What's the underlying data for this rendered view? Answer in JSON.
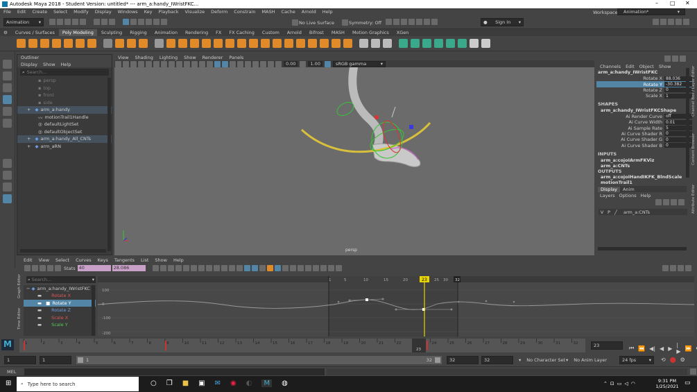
{
  "window": {
    "title": "Autodesk Maya 2018 - Student Version: untitled*   ---   arm_a:handy_IWristFKC...",
    "controls": [
      "–",
      "□",
      "✕"
    ]
  },
  "menu": [
    "File",
    "Edit",
    "Create",
    "Select",
    "Modify",
    "Display",
    "Windows",
    "Key",
    "Playback",
    "Visualize",
    "Deform",
    "Constrain",
    "MASH",
    "Cache",
    "Arnold",
    "Help"
  ],
  "workspace": {
    "label": "Workspace :",
    "value": "Animation*"
  },
  "statusline": {
    "menuset": "Animation",
    "live_surface": "No Live Surface",
    "symmetry": "Symmetry: Off",
    "sign_in": "Sign In"
  },
  "shelf_tabs": [
    "Curves / Surfaces",
    "Poly Modeling",
    "Sculpting",
    "Rigging",
    "Animation",
    "Rendering",
    "FX",
    "FX Caching",
    "Custom",
    "Arnold",
    "Bifrost",
    "MASH",
    "Motion Graphics",
    "XGen"
  ],
  "shelf_tab_active": "Poly Modeling",
  "colors": {
    "selection": "#5285a6",
    "timeline_marker": "#e8d400",
    "curve_yellow": "#d9c03c",
    "viewport": "#6b6b6b",
    "key_red": "#c33"
  },
  "outliner": {
    "title": "Outliner",
    "menu": [
      "Display",
      "Show",
      "Help"
    ],
    "search_placeholder": "Search...",
    "items": [
      {
        "label": "persp",
        "dim": true,
        "icon": "camera-icon"
      },
      {
        "label": "top",
        "dim": true,
        "icon": "camera-icon"
      },
      {
        "label": "front",
        "dim": true,
        "icon": "camera-icon"
      },
      {
        "label": "side",
        "dim": true,
        "icon": "camera-icon"
      },
      {
        "label": "arm_a:handy",
        "dim": false,
        "icon": "group-icon",
        "expander": true,
        "selected": true
      },
      {
        "label": "motionTrail1Handle",
        "dim": false,
        "icon": "motion-trail-icon"
      },
      {
        "label": "defaultLightSet",
        "dim": false,
        "icon": "set-icon"
      },
      {
        "label": "defaultObjectSet",
        "dim": false,
        "icon": "set-icon"
      },
      {
        "label": "arm_a:handy_All_CNTs",
        "dim": false,
        "icon": "group-icon",
        "expander": true,
        "selected": true
      },
      {
        "label": "arm_aRN",
        "dim": false,
        "icon": "reference-icon",
        "expander": true
      }
    ]
  },
  "viewport": {
    "menu": [
      "View",
      "Shading",
      "Lighting",
      "Show",
      "Renderer",
      "Panels"
    ],
    "exposure": "0.00",
    "gamma": "1.00",
    "colorspace": "sRGB gamma",
    "camera_label": "persp"
  },
  "channel_box": {
    "menu": [
      "Channels",
      "Edit",
      "Object",
      "Show"
    ],
    "node": "arm_a:handy_IWristFKC",
    "attributes": [
      {
        "name": "Rotate X",
        "value": "88.036",
        "highlighted": false
      },
      {
        "name": "Rotate Y",
        "value": "-30.382",
        "highlighted": true
      },
      {
        "name": "Rotate Z",
        "value": "0",
        "highlighted": false
      },
      {
        "name": "Scale X",
        "value": "1",
        "highlighted": false
      }
    ],
    "shapes_header": "SHAPES",
    "shape_node": "arm_a:handy_IWristFKCShape",
    "shape_attributes": [
      {
        "name": "Ai Render Curve",
        "value": "off"
      },
      {
        "name": "Ai Curve Width",
        "value": "0.01"
      },
      {
        "name": "Ai Sample Rate",
        "value": "5"
      },
      {
        "name": "Ai Curve Shader R",
        "value": "0"
      },
      {
        "name": "Ai Curve Shader G",
        "value": "0"
      },
      {
        "name": "Ai Curve Shader B",
        "value": "0"
      }
    ],
    "inputs_header": "INPUTS",
    "inputs": [
      "arm_a:cojoIArmFKViz",
      "arm_a:CNTs"
    ],
    "outputs_header": "OUTPUTS",
    "outputs": [
      "arm_a:cojoIHandIKFK_BlndScale",
      "motionTrail1"
    ],
    "layer_tabs": [
      "Display",
      "Anim"
    ],
    "layer_menu": [
      "Layers",
      "Options",
      "Help"
    ],
    "layer": {
      "v": "V",
      "p": "P",
      "name": "arm_a:CNTs"
    },
    "side_tabs": [
      "Channel Box / Layer Editor",
      "Content Browser",
      "Attribute Editor"
    ]
  },
  "graph_editor": {
    "menu": [
      "Edit",
      "View",
      "Select",
      "Curves",
      "Keys",
      "Tangents",
      "List",
      "Show",
      "Help"
    ],
    "stats_label": "Stats",
    "stats_values": [
      "40",
      "28.086"
    ],
    "search_placeholder": "Search...",
    "side_tabs": [
      "Graph Editor",
      "Time Editor"
    ],
    "channels": [
      {
        "label": "arm_a:handy_IWristFKC",
        "color": "#ccc",
        "selected": false
      },
      {
        "label": "Rotate X",
        "color": "#d55",
        "selected": false
      },
      {
        "label": "Rotate Y",
        "color": "#fff",
        "selected": true
      },
      {
        "label": "Rotate Z",
        "color": "#6a9de0",
        "selected": false
      },
      {
        "label": "Scale X",
        "color": "#d55",
        "selected": false
      },
      {
        "label": "Scale Y",
        "color": "#5c5",
        "selected": false
      }
    ],
    "y_labels": [
      "100",
      "0",
      "-100",
      "-200"
    ],
    "frame_labels": [
      "1",
      "5",
      "10",
      "15",
      "20",
      "23",
      "25",
      "30",
      "32"
    ],
    "current_frame": "23"
  },
  "time_slider": {
    "ticks": [
      "1",
      "2",
      "3",
      "4",
      "5",
      "6",
      "7",
      "8",
      "9",
      "10",
      "11",
      "12",
      "13",
      "14",
      "15",
      "16",
      "17",
      "18",
      "19",
      "20",
      "21",
      "22",
      "23",
      "24",
      "25",
      "26",
      "27",
      "28",
      "29",
      "30",
      "31",
      "32"
    ],
    "current_frame": "23",
    "current_frame_field": "23"
  },
  "range_slider": {
    "start": "1",
    "playback_start": "1",
    "bar_start": "1",
    "bar_end": "32",
    "playback_end": "32",
    "end": "32",
    "character_set": "No Character Set",
    "anim_layer": "No Anim Layer",
    "fps": "24 fps"
  },
  "mel": {
    "label": "MEL"
  },
  "taskbar": {
    "search_placeholder": "Type here to search",
    "time": "9:31 PM",
    "date": "1/25/2021"
  }
}
